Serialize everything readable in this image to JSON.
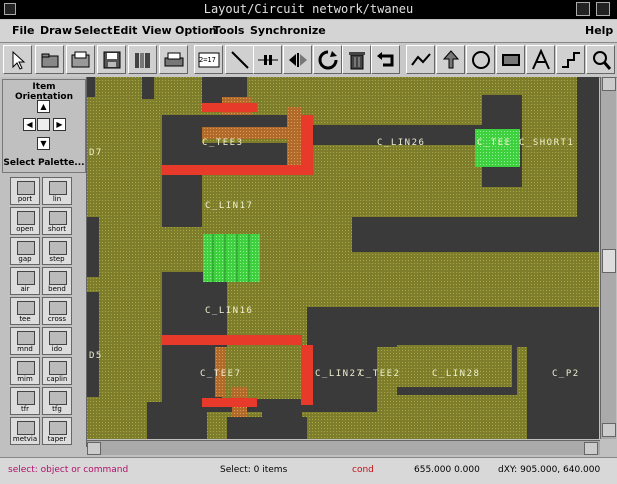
{
  "window": {
    "title": "Layout/Circuit network/twaneu"
  },
  "menu": {
    "items": [
      "File",
      "Draw",
      "Select",
      "Edit",
      "View",
      "Option",
      "Tools",
      "Synchronize"
    ],
    "help": "Help"
  },
  "toolbar": {
    "buttons": [
      "select-arrow",
      "open-folder",
      "open-file",
      "save",
      "library",
      "print",
      "zoom-ratio",
      "draw-line",
      "component-place",
      "flip",
      "rotate",
      "delete",
      "undo",
      "polyline",
      "arrow",
      "circle",
      "rectangle",
      "text",
      "step",
      "zoom"
    ],
    "zoom_ratio_label": "2=17"
  },
  "orientation": {
    "title": "Item Orientation",
    "select_palette": "Select Palette..."
  },
  "palette": {
    "items": [
      "port",
      "lin",
      "open",
      "short",
      "gap",
      "step",
      "air",
      "bend",
      "tee",
      "cross",
      "mnd",
      "ido",
      "mim",
      "caplin",
      "tfr",
      "tfg",
      "metvia",
      "taper"
    ]
  },
  "canvas": {
    "labels": {
      "c_tee3": "C_TEE3",
      "c_lin26": "C_LIN26",
      "c_tee_short": "C_TEE",
      "c_short1": "C_SHORT1",
      "c_lin17": "C_LIN17",
      "c_lin16": "C_LIN16",
      "c_tee7": "C_TEE7",
      "c_lin27": "C_LIN27",
      "c_tee2": "C_TEE2",
      "c_lin28": "C_LIN28",
      "c_p2": "C_P2",
      "edge_d7": "D7",
      "edge_d5": "D5"
    },
    "colors": {
      "substrate": "#7d7d2b",
      "metal": "#3a3a3a",
      "junction": "#e83a2a",
      "via": "#4fe04f",
      "hatch": "#b06a2c"
    }
  },
  "status": {
    "prompt": "select: object or command",
    "select": "Select:  0 items",
    "mode": "cond",
    "coords": "655.000 0.000",
    "dxy": "dXY: 905.000, 640.000"
  }
}
